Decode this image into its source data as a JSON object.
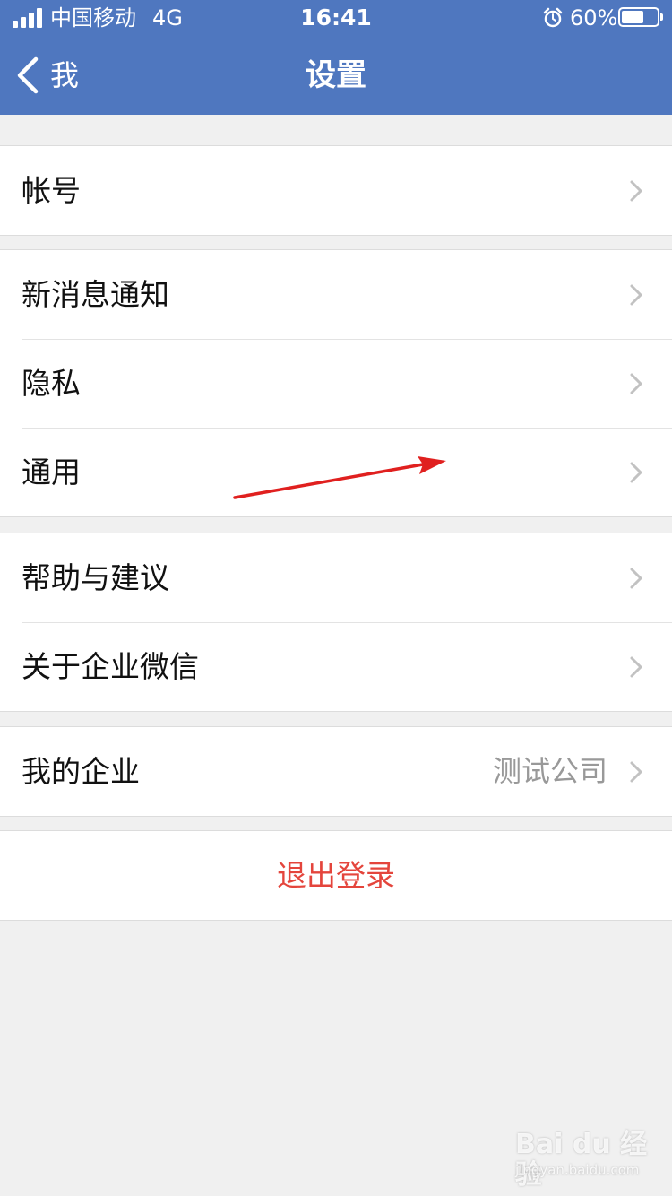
{
  "status_bar": {
    "carrier": "中国移动",
    "network": "4G",
    "time": "16:41",
    "battery_percent": "60%",
    "battery_level": 0.6,
    "icons": [
      "signal-icon",
      "alarm-icon",
      "battery-icon"
    ]
  },
  "nav": {
    "back_label": "我",
    "title": "设置"
  },
  "groups": [
    {
      "items": [
        {
          "label": "帐号"
        }
      ]
    },
    {
      "items": [
        {
          "label": "新消息通知"
        },
        {
          "label": "隐私"
        },
        {
          "label": "通用"
        }
      ]
    },
    {
      "items": [
        {
          "label": "帮助与建议"
        },
        {
          "label": "关于企业微信"
        }
      ]
    },
    {
      "items": [
        {
          "label": "我的企业",
          "value": "测试公司"
        }
      ]
    }
  ],
  "logout_label": "退出登录",
  "watermark": {
    "main": "Bai du 经验",
    "sub": "jingyan.baidu.com"
  },
  "colors": {
    "header": "#4f77bf",
    "background": "#f0f0f0",
    "logout": "#e4453c",
    "annotation_arrow": "#e0201f"
  }
}
